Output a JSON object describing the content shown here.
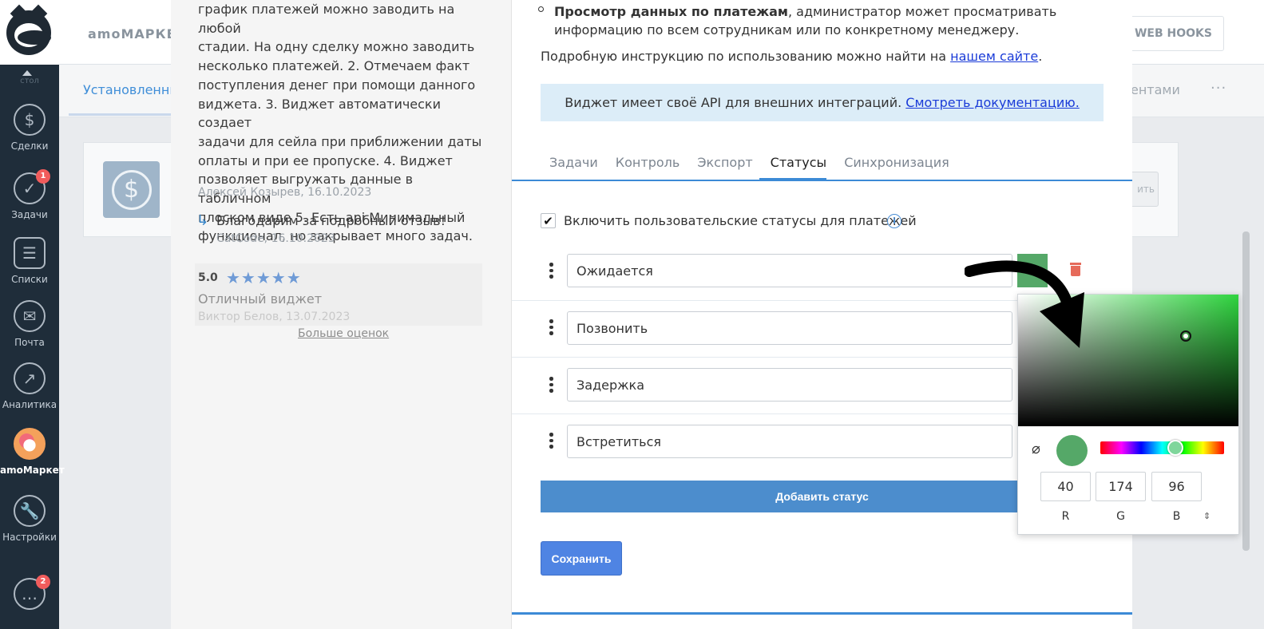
{
  "sidebar": {
    "scroll_up_label": "стол",
    "items": [
      {
        "label": "Сделки",
        "icon": "deals-dollar-icon",
        "badge": ""
      },
      {
        "label": "Задачи",
        "icon": "tasks-check-icon",
        "badge": "1"
      },
      {
        "label": "Списки",
        "icon": "lists-icon",
        "badge": ""
      },
      {
        "label": "Почта",
        "icon": "mail-icon",
        "badge": ""
      },
      {
        "label": "Аналитика",
        "icon": "analytics-icon",
        "badge": ""
      },
      {
        "label": "amoМаркет",
        "icon": "amomarket-icon",
        "badge": ""
      },
      {
        "label": "Настройки",
        "icon": "settings-wrench-icon",
        "badge": ""
      }
    ],
    "chat_badge": "2"
  },
  "background": {
    "app_title": "amoМАРКЕ",
    "webhooks_label": "WEB HOOKS",
    "tab_installed": "Установленны",
    "tab_clients": "ентами",
    "more_dots": "···",
    "install_button_fragment": "ить"
  },
  "reviews": {
    "review_text": "график платежей можно заводить на любой\nстадии. На одну сделку можно заводить\nнесколько платежей. 2. Отмечаем факт\nпоступления денег при помощи данного\nвиджета. 3. Виджет автоматически создает\nзадачи для сейла при приближении даты\nоплаты и при ее пропуске. 4. Виджет\nпозволяет выгружать данные в табличном\nплоском виде 5. Есть api Минимальный\nфункционал, но закрывает много задач.",
    "review_author": "Алексей Козырев, 16.10.2023",
    "reply_text": "Благодарим за подробный отзыв!",
    "reply_author": "CatCode, 16.10.2023",
    "rating_value": "5.0",
    "rating_stars": "★★★★★",
    "rating_title": "Отличный виджет",
    "rating_author": "Виктор Белов, 13.07.2023",
    "more_ratings": "Больше оценок"
  },
  "settings": {
    "bullet_bold": "Просмотр данных по платежам",
    "bullet_rest": ", администратор может просматривать информацию по всем сотрудникам или по конкретному менеджеру.",
    "instruction_text": "Подробную инструкцию по использованию можно найти на ",
    "instruction_link": "нашем сайте",
    "instruction_end": ".",
    "api_text": "Виджет имеет своё API для внешних интеграций. ",
    "api_link": "Смотреть документацию.",
    "tabs": [
      "Задачи",
      "Контроль",
      "Экспорт",
      "Статусы",
      "Синхронизация"
    ],
    "active_tab": "Статусы",
    "custom_statuses_label": "Включить пользовательские статусы для платежей",
    "custom_statuses_checked": true,
    "statuses": [
      "Ожидается",
      "Позвонить",
      "Задержка",
      "Встретиться"
    ],
    "add_status_label": "Добавить статус",
    "save_label": "Сохранить"
  },
  "color_picker": {
    "r": "40",
    "g": "174",
    "b": "96",
    "r_label": "R",
    "g_label": "G",
    "b_label": "B",
    "swatch_color": "#55a868",
    "mode_switch_icon": "⇕"
  }
}
